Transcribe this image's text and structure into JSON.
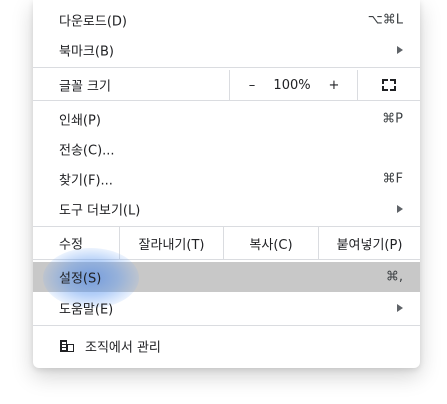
{
  "menu": {
    "downloads": {
      "label": "다운로드(D)",
      "shortcut": "⌥⌘L"
    },
    "bookmarks": {
      "label": "북마크(B)"
    },
    "zoom": {
      "label": "글꼴 크기",
      "minus": "–",
      "level": "100%",
      "plus": "+",
      "icon": "fullscreen-icon"
    },
    "print": {
      "label": "인쇄(P)",
      "shortcut": "⌘P"
    },
    "cast": {
      "label": "전송(C)..."
    },
    "find": {
      "label": "찾기(F)...",
      "shortcut": "⌘F"
    },
    "more_tools": {
      "label": "도구 더보기(L)"
    },
    "edit": {
      "label": "수정",
      "cut": "잘라내기(T)",
      "copy": "복사(C)",
      "paste": "붙여넣기(P)"
    },
    "settings": {
      "label": "설정(S)",
      "shortcut": "⌘,"
    },
    "help": {
      "label": "도움말(E)"
    },
    "managed": {
      "label": "조직에서 관리",
      "icon": "building-icon"
    }
  },
  "colors": {
    "highlight": "#c8c8c8",
    "ripple": "#4a86e8",
    "separator": "#dadce0"
  }
}
